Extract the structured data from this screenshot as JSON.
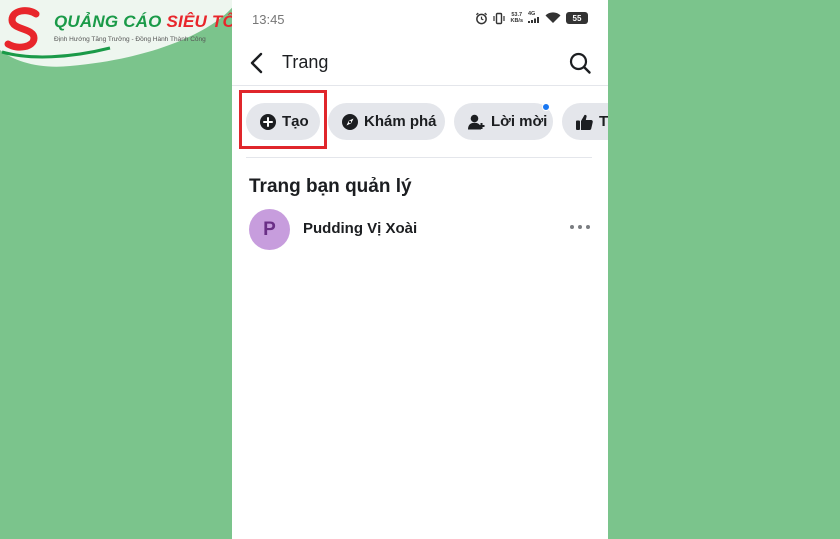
{
  "watermark": {
    "title_green": "QUẢNG CÁO",
    "title_red": "SIÊU TỐC",
    "subtitle": "Định Hướng Tăng Trưởng - Đồng Hành Thành Công"
  },
  "status_bar": {
    "time": "13:45",
    "net_speed_value": "53.7",
    "net_speed_unit": "KB/s",
    "net_type": "4G",
    "battery": "55"
  },
  "nav": {
    "title": "Trang",
    "back_icon": "chevron-left-icon",
    "search_icon": "search-icon"
  },
  "chips": [
    {
      "label": "Tạo",
      "icon": "plus-circle-icon",
      "highlighted": true
    },
    {
      "label": "Khám phá",
      "icon": "compass-icon"
    },
    {
      "label": "Lời mời",
      "icon": "person-add-icon",
      "badge": true
    },
    {
      "label": "Tr",
      "icon": "thumbs-up-icon"
    }
  ],
  "section": {
    "title": "Trang bạn quản lý"
  },
  "pages": [
    {
      "initial": "P",
      "name": "Pudding Vị Xoài"
    }
  ],
  "colors": {
    "background": "#7bc48c",
    "highlight": "#e0262b",
    "chip_bg": "#e4e6eb",
    "notification_dot": "#1877f2",
    "avatar_bg": "#c79ddd"
  }
}
